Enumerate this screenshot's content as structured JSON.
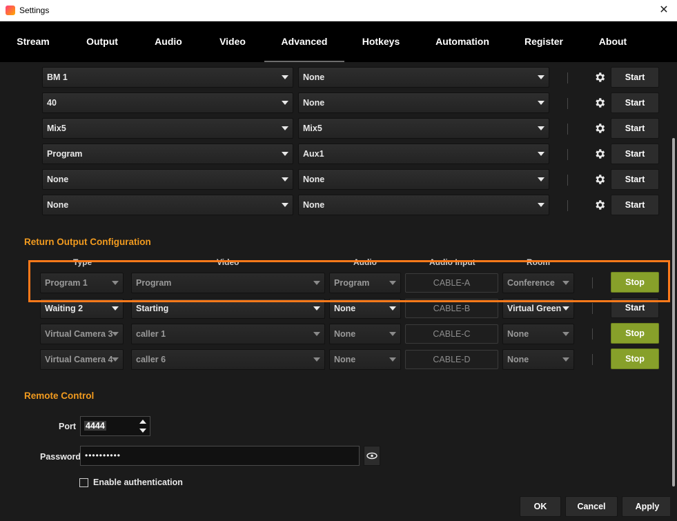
{
  "window": {
    "title": "Settings",
    "close_glyph": "✕"
  },
  "tabs": [
    {
      "label": "Stream"
    },
    {
      "label": "Output"
    },
    {
      "label": "Audio"
    },
    {
      "label": "Video"
    },
    {
      "label": "Advanced",
      "active": true
    },
    {
      "label": "Hotkeys"
    },
    {
      "label": "Automation"
    },
    {
      "label": "Register"
    },
    {
      "label": "About"
    }
  ],
  "inputs_rows": [
    {
      "source": "BM 1",
      "target": "None",
      "button": "Start"
    },
    {
      "source": "40",
      "target": "None",
      "button": "Start"
    },
    {
      "source": "Mix5",
      "target": "Mix5",
      "button": "Start"
    },
    {
      "source": "Program",
      "target": "Aux1",
      "button": "Start"
    },
    {
      "source": "None",
      "target": "None",
      "button": "Start"
    },
    {
      "source": "None",
      "target": "None",
      "button": "Start"
    }
  ],
  "return_output": {
    "title": "Return Output Configuration",
    "columns": [
      "Type",
      "Video",
      "Audio",
      "Audio Input",
      "Room"
    ],
    "rows": [
      {
        "type": "Program 1",
        "video": "Program",
        "audio": "Program",
        "audio_input": "CABLE-A",
        "room": "Conference",
        "button": "Stop",
        "active": true,
        "dim": true
      },
      {
        "type": "Waiting 2",
        "video": "Starting",
        "audio": "None",
        "audio_input": "CABLE-B",
        "room": "Virtual Green",
        "button": "Start",
        "active": false,
        "dim": false
      },
      {
        "type": "Virtual Camera 3",
        "video": "caller 1",
        "audio": "None",
        "audio_input": "CABLE-C",
        "room": "None",
        "button": "Stop",
        "active": true,
        "dim": true
      },
      {
        "type": "Virtual Camera 4",
        "video": "caller 6",
        "audio": "None",
        "audio_input": "CABLE-D",
        "room": "None",
        "button": "Stop",
        "active": true,
        "dim": true
      }
    ]
  },
  "remote_control": {
    "title": "Remote Control",
    "port_label": "Port",
    "port_value": "4444",
    "password_label": "Password",
    "password_value": "••••••••••",
    "enable_auth_label": "Enable authentication",
    "enable_auth_checked": false
  },
  "footer": {
    "ok": "OK",
    "cancel": "Cancel",
    "apply": "Apply"
  },
  "colors": {
    "accent": "#f29b1f",
    "stop_button": "#87a02a",
    "highlight": "#ff7a1a"
  }
}
